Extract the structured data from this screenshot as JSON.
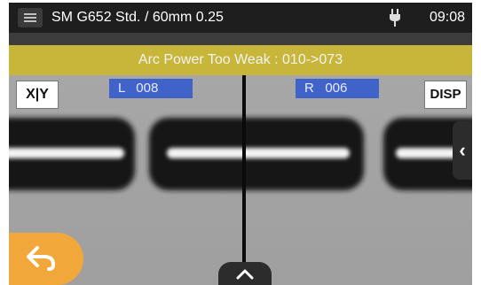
{
  "statusbar": {
    "title": "SM G652 Std. / 60mm 0.25",
    "time": "09:08",
    "icons": [
      "menu-icon",
      "plug-icon"
    ]
  },
  "banner": {
    "text": "Arc Power Too Weak : 010->073",
    "color": "#c7b63a"
  },
  "view": {
    "xy_label": "X|Y",
    "disp_label": "DISP",
    "left_readout": "L   008",
    "right_readout": "R   006"
  },
  "controls": {
    "side_tab_glyph": "‹",
    "back_icon": "back-arrow-icon",
    "bottom_tab_icon": "chevron-up-icon"
  }
}
